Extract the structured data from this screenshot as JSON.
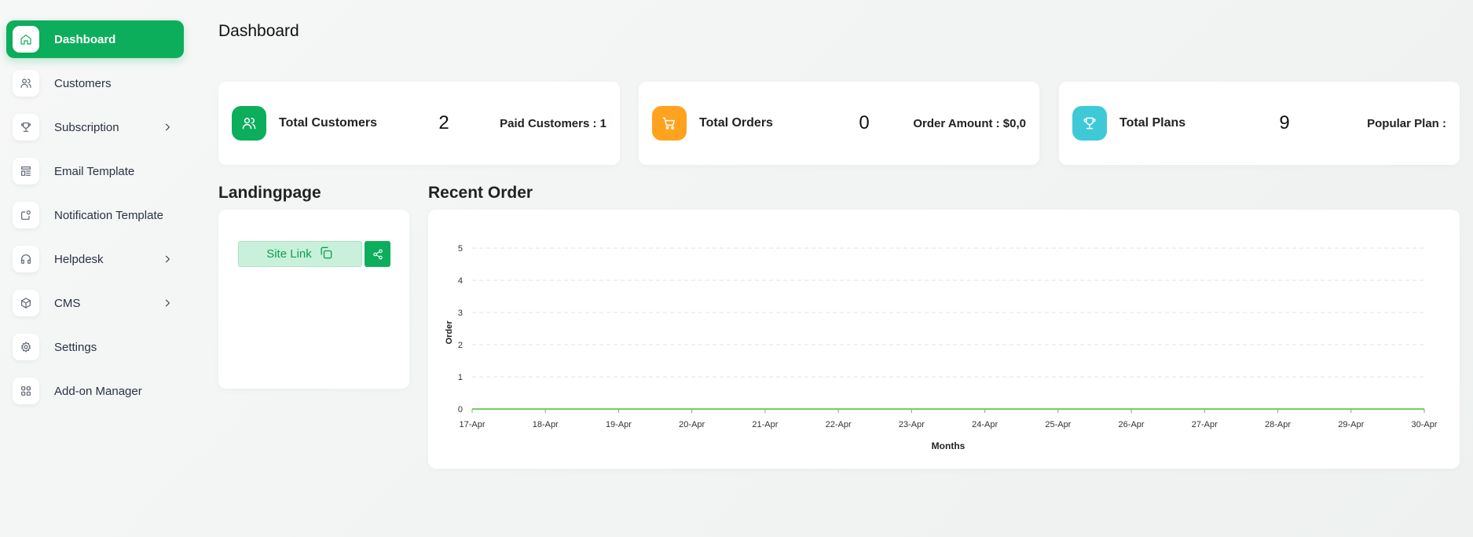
{
  "sidebar": {
    "items": [
      {
        "label": "Dashboard",
        "icon": "home-icon"
      },
      {
        "label": "Customers",
        "icon": "users-icon"
      },
      {
        "label": "Subscription",
        "icon": "trophy-icon"
      },
      {
        "label": "Email Template",
        "icon": "template-icon"
      },
      {
        "label": "Notification Template",
        "icon": "notification-icon"
      },
      {
        "label": "Helpdesk",
        "icon": "headset-icon"
      },
      {
        "label": "CMS",
        "icon": "box-icon"
      },
      {
        "label": "Settings",
        "icon": "gear-icon"
      },
      {
        "label": "Add-on Manager",
        "icon": "apps-icon"
      }
    ]
  },
  "header": {
    "title": "Dashboard"
  },
  "stats": [
    {
      "label": "Total Customers",
      "value": "2",
      "extra": "Paid Customers : 1",
      "color": "#0cae5c",
      "icon": "users-icon"
    },
    {
      "label": "Total Orders",
      "value": "0",
      "extra": "Order Amount : $0,0",
      "color": "#ffa21d",
      "icon": "cart-icon"
    },
    {
      "label": "Total Plans",
      "value": "9",
      "extra": "Popular Plan :",
      "color": "#3ec9d6",
      "icon": "trophy-icon"
    }
  ],
  "landing": {
    "title": "Landingpage",
    "site_link_label": "Site Link"
  },
  "recent_order": {
    "title": "Recent Order"
  },
  "colors": {
    "accent": "#0cae5c",
    "line": "#6fd05a"
  },
  "chart_data": {
    "type": "line",
    "xlabel": "Months",
    "ylabel": "Order",
    "ylim": [
      0,
      5
    ],
    "y_ticks": [
      0,
      1,
      2,
      3,
      4,
      5
    ],
    "categories": [
      "17-Apr",
      "18-Apr",
      "19-Apr",
      "20-Apr",
      "21-Apr",
      "22-Apr",
      "23-Apr",
      "24-Apr",
      "25-Apr",
      "26-Apr",
      "27-Apr",
      "28-Apr",
      "29-Apr",
      "30-Apr"
    ],
    "series": [
      {
        "values": [
          0,
          0,
          0,
          0,
          0,
          0,
          0,
          0,
          0,
          0,
          0,
          0,
          0,
          0
        ]
      }
    ],
    "grid": true
  }
}
